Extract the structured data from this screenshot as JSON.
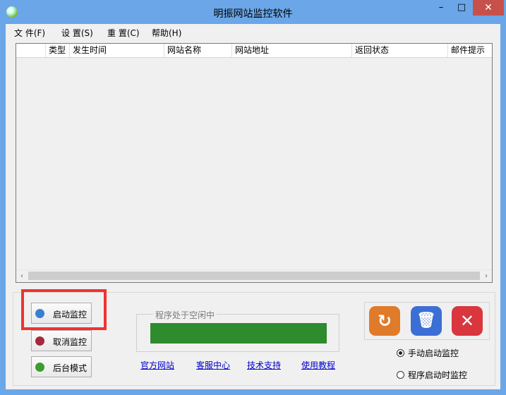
{
  "window": {
    "title": "明振网站监控软件",
    "min_glyph": "–",
    "max_glyph": "□",
    "close_glyph": "✕"
  },
  "menu": {
    "file": "文 件(F)",
    "settings": "设 置(S)",
    "reset": "重 置(C)",
    "help": "帮助(H)"
  },
  "table": {
    "columns": [
      "类型",
      "发生时间",
      "网站名称",
      "网站地址",
      "返回状态",
      "邮件提示"
    ],
    "rows": []
  },
  "scrollbar": {
    "left": "‹",
    "right": "›"
  },
  "buttons": {
    "start": "启动监控",
    "cancel": "取消监控",
    "background": "后台模式"
  },
  "status": {
    "label": "程序处于空闲中",
    "progress_color": "#2e8b2e"
  },
  "links": {
    "official": "官方网站",
    "service": "客服中心",
    "support": "技术支持",
    "tutorial": "使用教程"
  },
  "icons": {
    "refresh": "↻",
    "delete": "🗑",
    "exit": "✕"
  },
  "radios": {
    "manual": "手动启动监控",
    "auto": "程序启动时监控",
    "selected": "manual"
  },
  "colors": {
    "frame": "#6aa6e8",
    "close_button": "#c7504a",
    "highlight": "#f03232",
    "refresh_icon": "#e07b2a",
    "delete_icon": "#3b6fd6",
    "exit_icon": "#d9363e"
  }
}
